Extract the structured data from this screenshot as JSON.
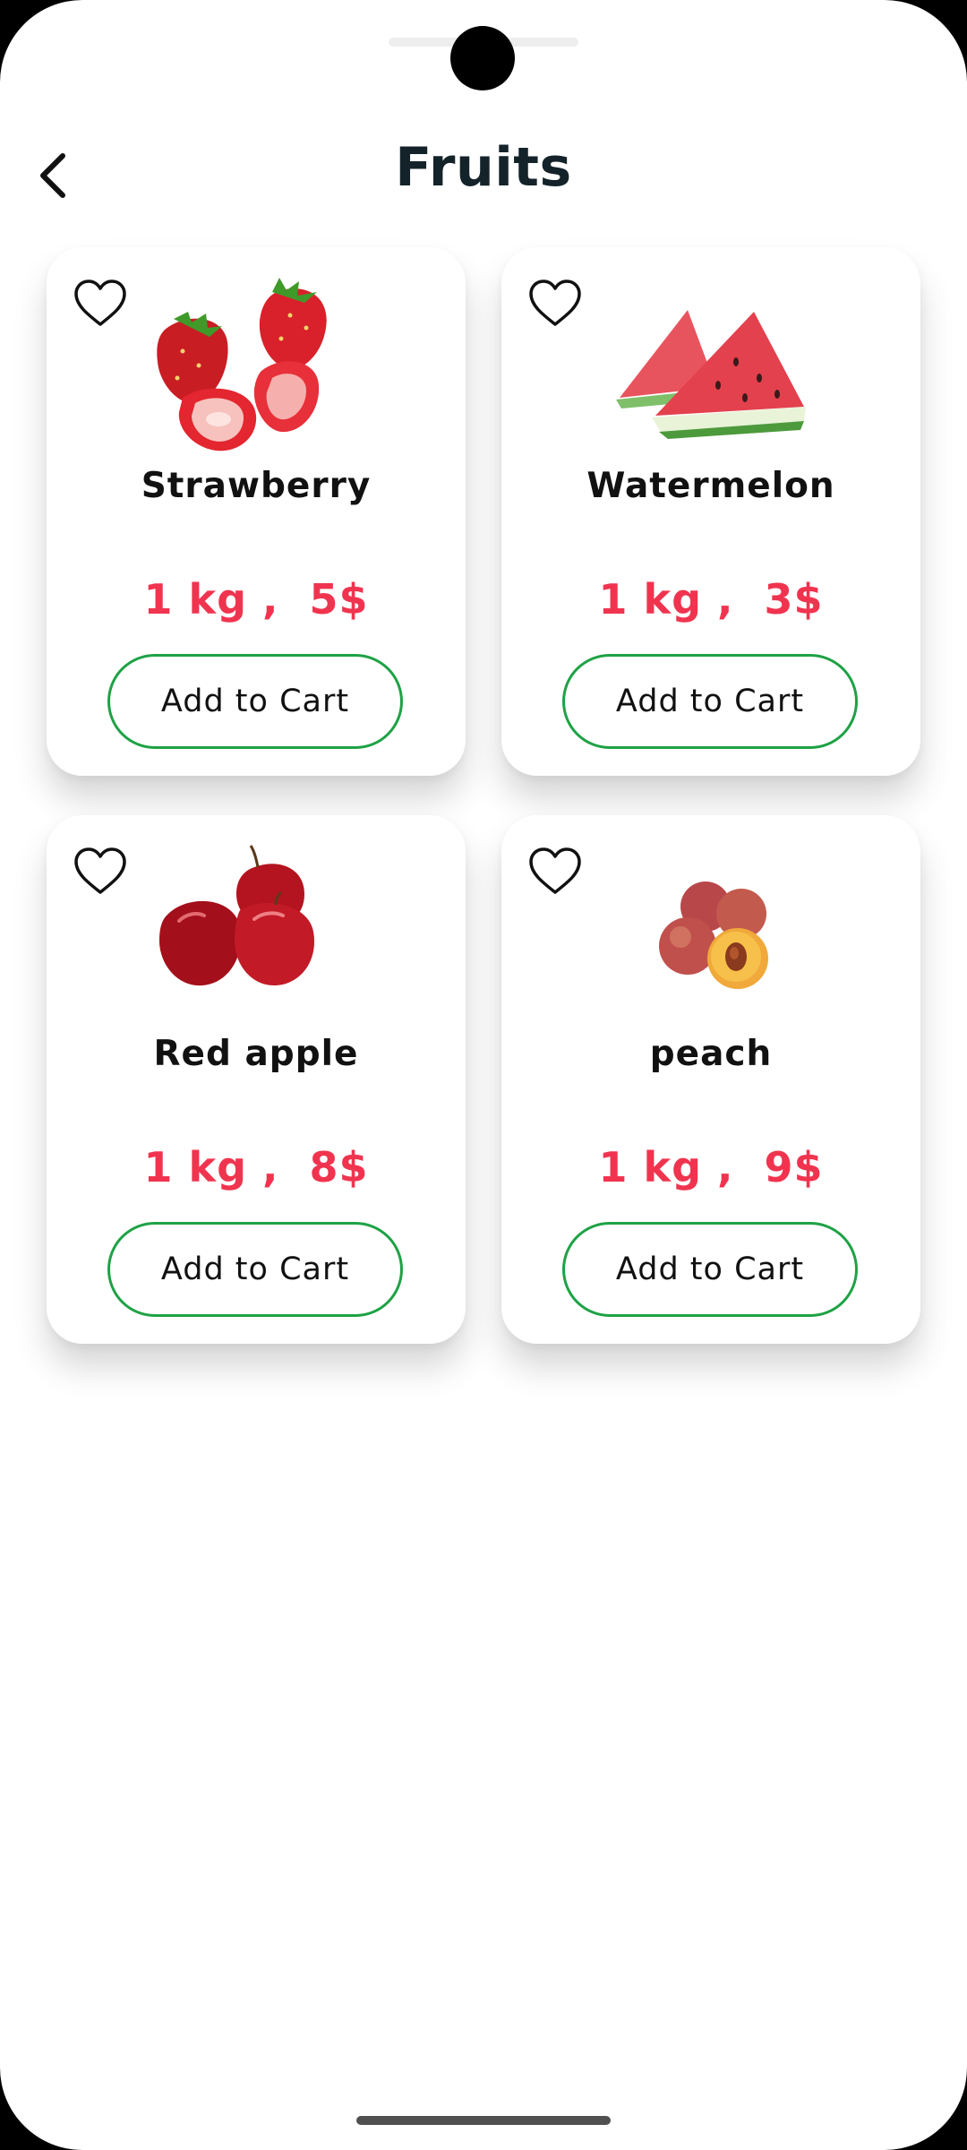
{
  "header": {
    "title": "Fruits",
    "back_icon": "chevron-left-icon"
  },
  "products": [
    {
      "name": "Strawberry",
      "price": "1 kg ,  5$",
      "cart_label": "Add to Cart",
      "favorite_icon": "heart-outline-icon",
      "image_icon": "strawberry-icon"
    },
    {
      "name": "Watermelon",
      "price": "1 kg ,  3$",
      "cart_label": "Add to Cart",
      "favorite_icon": "heart-outline-icon",
      "image_icon": "watermelon-slice-icon"
    },
    {
      "name": "Red apple",
      "price": "1 kg ,  8$",
      "cart_label": "Add to Cart",
      "favorite_icon": "heart-outline-icon",
      "image_icon": "red-apple-icon"
    },
    {
      "name": "peach",
      "price": "1 kg ,  9$",
      "cart_label": "Add to Cart",
      "favorite_icon": "heart-outline-icon",
      "image_icon": "peach-icon"
    }
  ],
  "colors": {
    "title": "#14232a",
    "price": "#f0344f",
    "button_border": "#1ea245",
    "card_background": "#ffffff"
  }
}
